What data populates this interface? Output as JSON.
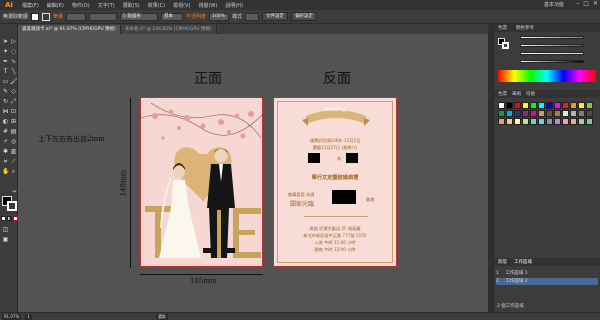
{
  "app": {
    "logo": "Ai",
    "workspace": "基本功能"
  },
  "menu": [
    "檔案(F)",
    "編輯(E)",
    "物件(O)",
    "文字(T)",
    "選取(S)",
    "效果(C)",
    "檢視(V)",
    "視窗(W)",
    "說明(H)"
  ],
  "window_controls": [
    "–",
    "□",
    "✕"
  ],
  "control_bar": {
    "selection": "無選取範圍",
    "stroke_label": "筆畫",
    "stroke_value": "",
    "brush": "5 點圓形",
    "style_label": "基本",
    "opacity_label": "不透明度",
    "opacity_value": "100%",
    "style_label2": "樣式",
    "doc_setup": "文件設定",
    "preferences": "偏好設定"
  },
  "tabs": [
    {
      "label": "喜宴邀請卡.ai* @ 91.07% (CMYK/GPU 預視)",
      "active": true
    },
    {
      "label": "未命名-2* @ 244.62% (CMYK/GPU 預視)",
      "active": false
    }
  ],
  "canvas": {
    "front_title": "正面",
    "back_title": "反面",
    "bleed_note": "上下左右各出血2mm",
    "height_dim": "148mm",
    "width_dim": "105mm"
  },
  "back_card": {
    "banner": "Wedding",
    "line1": "謹擇於民國106年   12月2日",
    "line2": "農曆11月27日   (星期六)",
    "line3": "為",
    "line4": "舉行文定暨結婚典禮",
    "line5_left": "敬備喜筵   恭請",
    "line5_right": "闔家光臨",
    "line5_end": "敬邀",
    "line6": "席設   好運大飯店   2F 福氣廳",
    "line7": "新北市新莊區中正路 777號 1155",
    "line8": "入席 午時 11:00   小時",
    "line9": "開席 午時 12:00   小時"
  },
  "panels": {
    "color_tabs": [
      "色票",
      "顏色參考"
    ],
    "swatch_tabs": [
      "色票",
      "筆刷",
      "符號"
    ],
    "layers_tabs": [
      "圖層",
      "工作區域"
    ],
    "artboards": [
      {
        "num": "1",
        "name": "工作區域 1"
      },
      {
        "num": "2",
        "name": "工作區域 2"
      }
    ],
    "artboards_footer": "2 個工作區域"
  },
  "status": {
    "zoom": "91.07%",
    "page": "1",
    "tool": "選取"
  },
  "colors": {
    "accent": "#ff9a00",
    "card_front_bg": "#f7d7d3",
    "card_back_bg": "#f8dcd7",
    "gold": "#a87a2a"
  }
}
